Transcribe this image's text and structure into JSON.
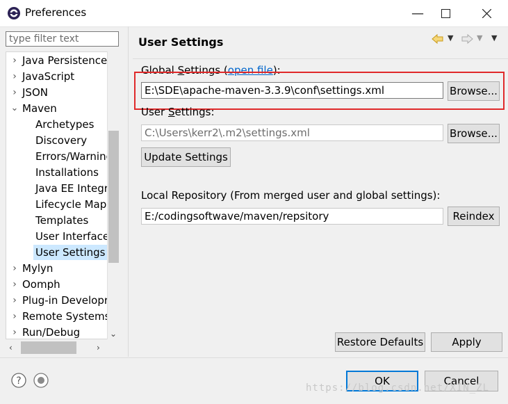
{
  "window": {
    "title": "Preferences"
  },
  "filter": {
    "placeholder": "type filter text"
  },
  "tree": {
    "items": [
      {
        "label": "Java Persistence",
        "level": 0,
        "twisty": "›"
      },
      {
        "label": "JavaScript",
        "level": 0,
        "twisty": "›"
      },
      {
        "label": "JSON",
        "level": 0,
        "twisty": "›"
      },
      {
        "label": "Maven",
        "level": 0,
        "twisty": "⌄"
      },
      {
        "label": "Archetypes",
        "level": 1
      },
      {
        "label": "Discovery",
        "level": 1
      },
      {
        "label": "Errors/Warning",
        "level": 1
      },
      {
        "label": "Installations",
        "level": 1
      },
      {
        "label": "Java EE Integra",
        "level": 1
      },
      {
        "label": "Lifecycle Mapp",
        "level": 1
      },
      {
        "label": "Templates",
        "level": 1
      },
      {
        "label": "User Interface",
        "level": 1
      },
      {
        "label": "User Settings",
        "level": 1,
        "selected": true
      },
      {
        "label": "Mylyn",
        "level": 0,
        "twisty": "›"
      },
      {
        "label": "Oomph",
        "level": 0,
        "twisty": "›"
      },
      {
        "label": "Plug-in Developr",
        "level": 0,
        "twisty": "›"
      },
      {
        "label": "Remote Systems",
        "level": 0,
        "twisty": "›"
      },
      {
        "label": "Run/Debug",
        "level": 0,
        "twisty": "›"
      }
    ]
  },
  "page": {
    "title": "User Settings",
    "global": {
      "label_prefix": "Global ",
      "label_mnemonic": "S",
      "label_rest": "ettings (",
      "link": "open file",
      "label_suffix": "):",
      "value": "E:\\SDE\\apache-maven-3.3.9\\conf\\settings.xml",
      "browse": "Browse..."
    },
    "user": {
      "label_prefix": "User ",
      "label_mnemonic": "S",
      "label_rest": "ettings:",
      "value": "C:\\Users\\kerr2\\.m2\\settings.xml",
      "browse": "Browse..."
    },
    "update_button": "Update Settings",
    "local_repo": {
      "label": "Local Repository (From merged user and global settings):",
      "value": "E:/codingsoftwave/maven/repsitory",
      "reindex": "Reindex"
    },
    "restore_defaults": "Restore Defaults",
    "apply": "Apply"
  },
  "footer": {
    "ok": "OK",
    "cancel": "Cancel",
    "watermark": "https://blog.csdn.net/XIN_ZL"
  },
  "icons": {
    "help": "help-icon",
    "import": "import-icon",
    "back": "back-arrow-icon",
    "forward": "forward-arrow-icon",
    "menu": "view-menu-icon"
  },
  "colors": {
    "highlight": "#e0292a",
    "selection": "#cce8ff",
    "link": "#0066cc",
    "accent": "#0078d7"
  }
}
